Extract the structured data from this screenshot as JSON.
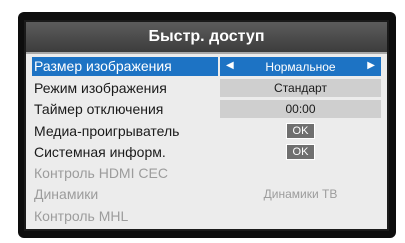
{
  "menu": {
    "title": "Быстр. доступ",
    "items": [
      {
        "label": "Размер изображения",
        "value": "Нормальное",
        "left_arrow": "◀",
        "right_arrow": "▶"
      },
      {
        "label": "Режим изображения",
        "value": "Стандарт"
      },
      {
        "label": "Таймер отключения",
        "value": "00:00"
      },
      {
        "label": "Медиа-проигрыватель",
        "value": "OK"
      },
      {
        "label": "Системная информ.",
        "value": "OK"
      },
      {
        "label": "Контроль HDMI CEC"
      },
      {
        "label": "Динамики",
        "value": "Динамики ТВ"
      },
      {
        "label": "Контроль MHL"
      }
    ]
  },
  "colors": {
    "selection": "#1d73c4",
    "title_bar": "#4a4a4a",
    "menu_bg": "#ececec",
    "disabled_text": "#9c9c9c"
  }
}
